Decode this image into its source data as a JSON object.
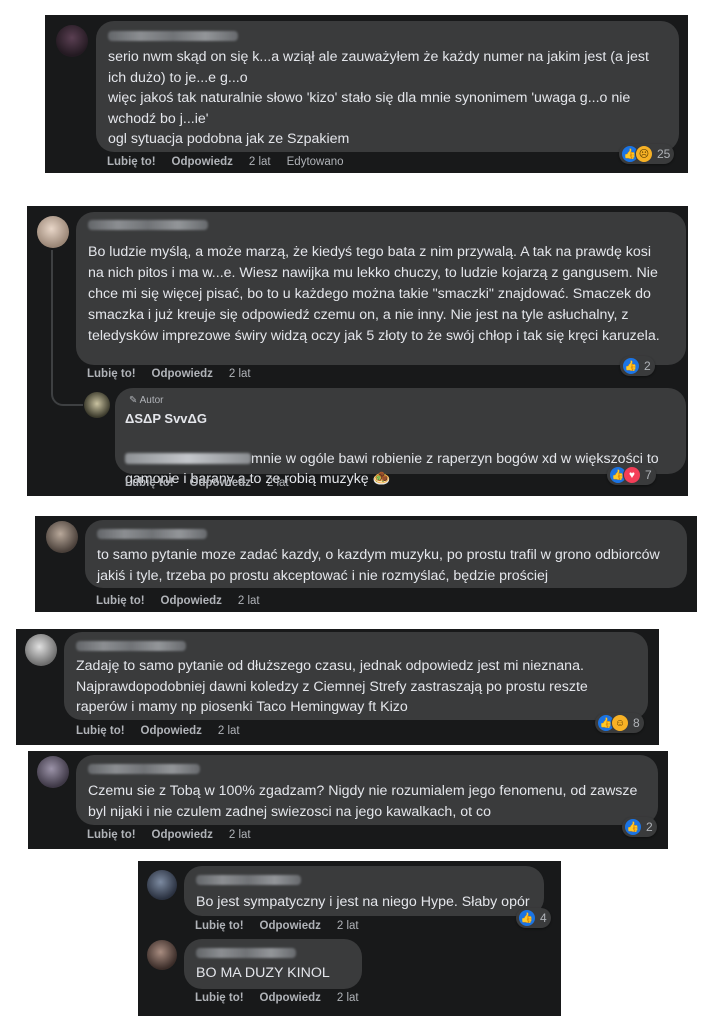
{
  "labels": {
    "like": "Lubię to!",
    "reply": "Odpowiedz"
  },
  "c1": {
    "text": "serio nwm skąd on się k...a wziął ale zauważyłem że każdy numer na jakim jest (a jest ich dużo) to je...e g...o\nwięc jakoś tak naturalnie słowo 'kizo' stało się dla mnie synonimem 'uwaga g...o nie wchodź bo j...ie'\nogl sytuacja podobna jak ze Szpakiem",
    "time": "2 lat",
    "edited": "Edytowano",
    "reaction_count": "25"
  },
  "c2": {
    "text": "Bo ludzie myślą, a może marzą, że kiedyś tego bata z nim przywalą. A tak na prawdę kosi na nich pitos i ma w...e. Wiesz nawijka mu lekko chuczy, to ludzie kojarzą z gangusem. Nie chce mi się więcej pisać, bo to u każdego można takie \"smaczki\" znajdować. Smaczek do smaczka i już kreuje się odpowiedź czemu on, a nie inny. Nie jest na tyle asłuchalny, z teledysków imprezowe świry widzą oczy jak 5 złoty to że swój chłop i tak się kręci karuzela.",
    "time": "2 lat",
    "reaction_count": "2"
  },
  "c2r": {
    "author_tag": "Autor",
    "author": "ΔSΔP SvvΔG",
    "text": "mnie w ogóle bawi robienie z raperzyn bogów xd w większości to gamonie i barany a to ze robią muzykę 🧆",
    "time": "2 lat",
    "reaction_count": "7"
  },
  "c3": {
    "text": "to samo pytanie moze zadać kazdy, o kazdym muzyku, po prostu trafil w grono odbiorców jakiś i tyle, trzeba po prostu akceptować i nie rozmyślać, będzie prościej",
    "time": "2 lat"
  },
  "c4": {
    "text": "Zadaję to samo pytanie od dłuższego czasu, jednak odpowiedz jest mi nieznana. Najprawdopodobniej dawni koledzy z Ciemnej Strefy zastraszają po prostu reszte raperów i mamy np piosenki Taco Hemingway ft Kizo",
    "time": "2 lat",
    "reaction_count": "8"
  },
  "c5": {
    "text": "Czemu sie z Tobą w 100% zgadzam? Nigdy nie rozumialem jego fenomenu, od zawsze byl nijaki i nie czulem zadnej swiezosci na jego kawalkach, ot co",
    "time": "2 lat",
    "reaction_count": "2"
  },
  "c6": {
    "text": "Bo jest sympatyczny i jest na niego Hype. Słaby opór",
    "time": "2 lat",
    "reaction_count": "4"
  },
  "c7": {
    "text": "BO MA DUZY KINOL",
    "time": "2 lat"
  }
}
